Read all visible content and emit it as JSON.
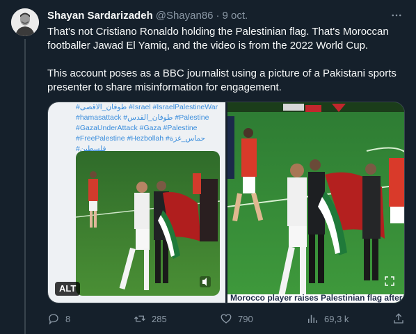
{
  "tweet": {
    "author_name": "Shayan Sardarizadeh",
    "author_handle": "@Shayan86",
    "separator": "·",
    "date": "9 oct.",
    "paragraph1": "That's not Cristiano Ronaldo holding the Palestinian flag. That's Moroccan footballer Jawad El Yamiq, and the video is from the 2022 World Cup.",
    "paragraph2": "This account poses as a BBC journalist using a picture of a Pakistani sports presenter to share misinformation for engagement."
  },
  "media": {
    "hashtag_lines": [
      "#طوفان_الاقصى #Israel #IsraelPalestineWar",
      "#hamasattack #طوفان_القدس #Palestine",
      "#GazaUnderAttack #Gaza #Palestine",
      "#FreePalestine #Hezbollah #حماس_غزة",
      "#فلسطين"
    ],
    "alt_label": "ALT",
    "caption_strip": "Morocco player raises Palestinian flag after"
  },
  "actions": {
    "replies": "8",
    "retweets": "285",
    "likes": "790",
    "views": "69,3 k"
  },
  "icons": {
    "more": "more-dots-icon",
    "reply": "reply-icon",
    "retweet": "retweet-icon",
    "like": "heart-icon",
    "views": "views-bars-icon",
    "share": "share-icon",
    "expand": "expand-icon"
  },
  "colors": {
    "background": "#15202b",
    "text": "#f7f9f9",
    "muted": "#8b98a5",
    "border": "#38444d",
    "hashtag": "#3a8ddc"
  }
}
